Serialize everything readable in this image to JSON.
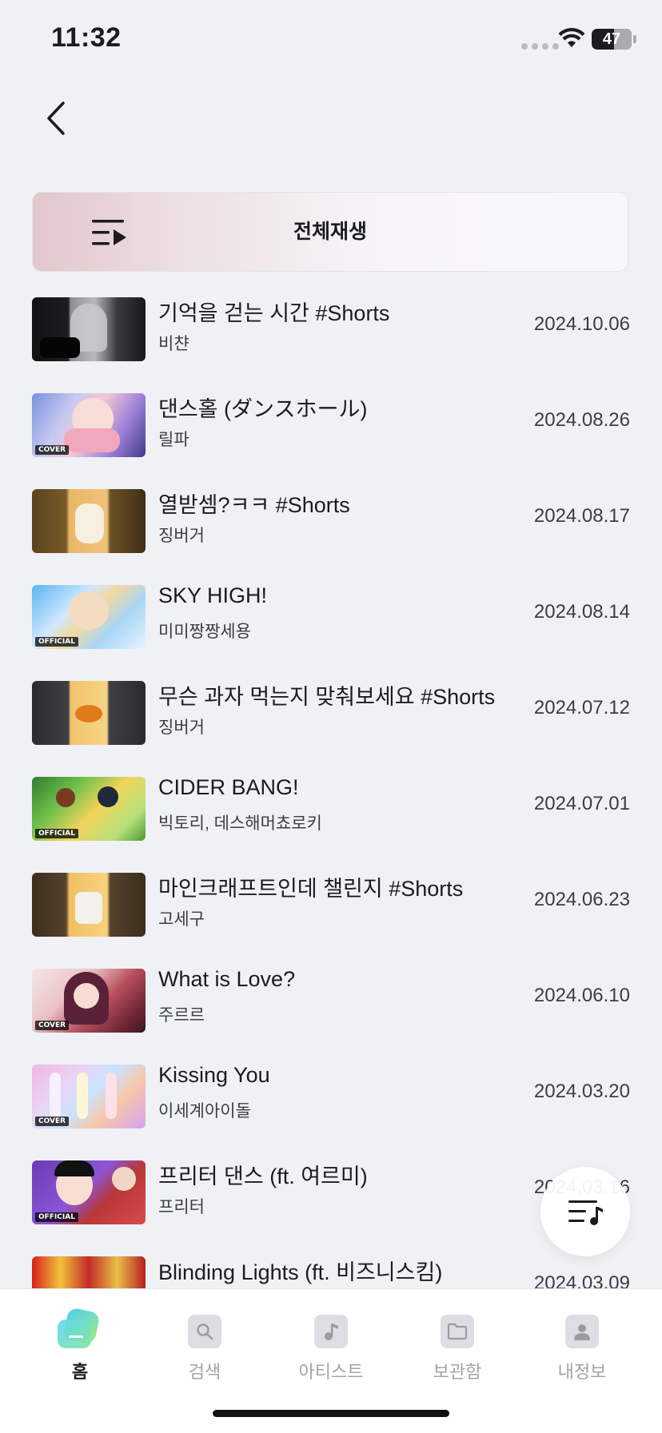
{
  "status_bar": {
    "time": "11:32",
    "battery": "47"
  },
  "header": {
    "back_icon": "chevron-left-icon"
  },
  "play_all": {
    "label": "전체재생",
    "icon": "playlist-play-icon"
  },
  "tracks": [
    {
      "title": "기억을 걷는 시간 #Shorts",
      "artist": "비챤",
      "date": "2024.10.06",
      "badge": ""
    },
    {
      "title": "댄스홀 (ダンスホール)",
      "artist": "릴파",
      "date": "2024.08.26",
      "badge": "COVER"
    },
    {
      "title": "열받셈?ㅋㅋ #Shorts",
      "artist": "징버거",
      "date": "2024.08.17",
      "badge": ""
    },
    {
      "title": "SKY HIGH!",
      "artist": "미미짱짱세용",
      "date": "2024.08.14",
      "badge": "OFFICIAL"
    },
    {
      "title": "무슨 과자 먹는지 맞춰보세요 #Shorts",
      "artist": "징버거",
      "date": "2024.07.12",
      "badge": ""
    },
    {
      "title": "CIDER BANG!",
      "artist": "빅토리, 데스해머쵸로키",
      "date": "2024.07.01",
      "badge": "OFFICIAL"
    },
    {
      "title": "마인크래프트인데 챌린지 #Shorts",
      "artist": "고세구",
      "date": "2024.06.23",
      "badge": ""
    },
    {
      "title": "What is Love?",
      "artist": "주르르",
      "date": "2024.06.10",
      "badge": "COVER"
    },
    {
      "title": "Kissing You",
      "artist": "이세계아이돌",
      "date": "2024.03.20",
      "badge": "COVER"
    },
    {
      "title": "프리터 댄스 (ft. 여르미)",
      "artist": "프리터",
      "date": "2024.03.16",
      "badge": "OFFICIAL"
    },
    {
      "title": "Blinding Lights (ft. 비즈니스킴)",
      "artist": "",
      "date": "2024.03.09",
      "badge": ""
    }
  ],
  "queue_button": {
    "icon": "music-queue-icon"
  },
  "nav": {
    "home": "홈",
    "search": "검색",
    "artist": "아티스트",
    "library": "보관함",
    "profile": "내정보"
  },
  "colors": {
    "background": "#f0f1f5",
    "play_all_gradient_start": "#e2c7cc",
    "home_icon_gradient": [
      "#4fd1e8",
      "#9be87d"
    ]
  }
}
